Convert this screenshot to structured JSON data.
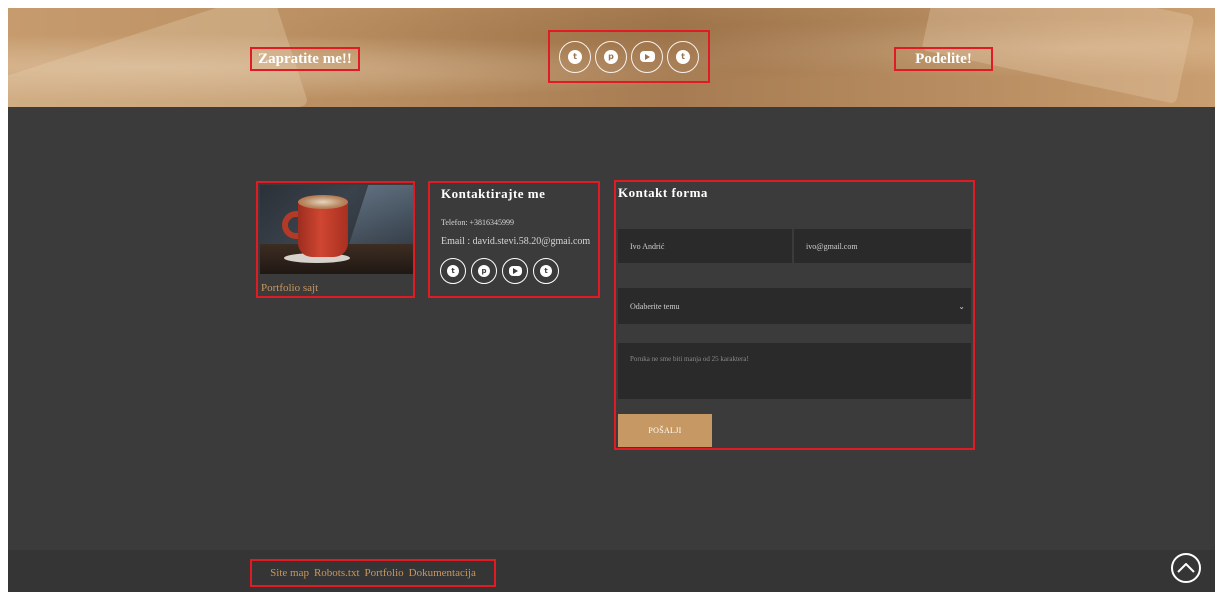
{
  "banner": {
    "follow_label": "Zapratite me!!",
    "share_label": "Podelite!",
    "social_icons": [
      "twitter-icon",
      "pinterest-icon",
      "youtube-icon",
      "twitter-icon"
    ]
  },
  "portfolio": {
    "link_label": "Portfolio sajt"
  },
  "contact": {
    "title": "Kontaktirajte me",
    "phone": "Telefon: +3816345999",
    "email": "Email : david.stevi.58.20@gmai.com",
    "social_icons": [
      "twitter-icon",
      "pinterest-icon",
      "youtube-icon",
      "twitter-icon"
    ]
  },
  "form": {
    "title": "Kontakt forma",
    "name_value": "Ivo Andrić",
    "email_value": "ivo@gmail.com",
    "topic_value": "Odaberite temu",
    "message_placeholder": "Poruka ne sme biti manja od 25 karaktera!",
    "send_label": "POŠALJI"
  },
  "footer": {
    "links": [
      "Site map",
      "Robots.txt",
      "Portfolio",
      "Dokumentacija"
    ]
  },
  "colors": {
    "accent": "#c69863",
    "dark_bg": "#3b3b3b",
    "footer_bg": "#353535",
    "highlight_outline": "#e01b24"
  }
}
